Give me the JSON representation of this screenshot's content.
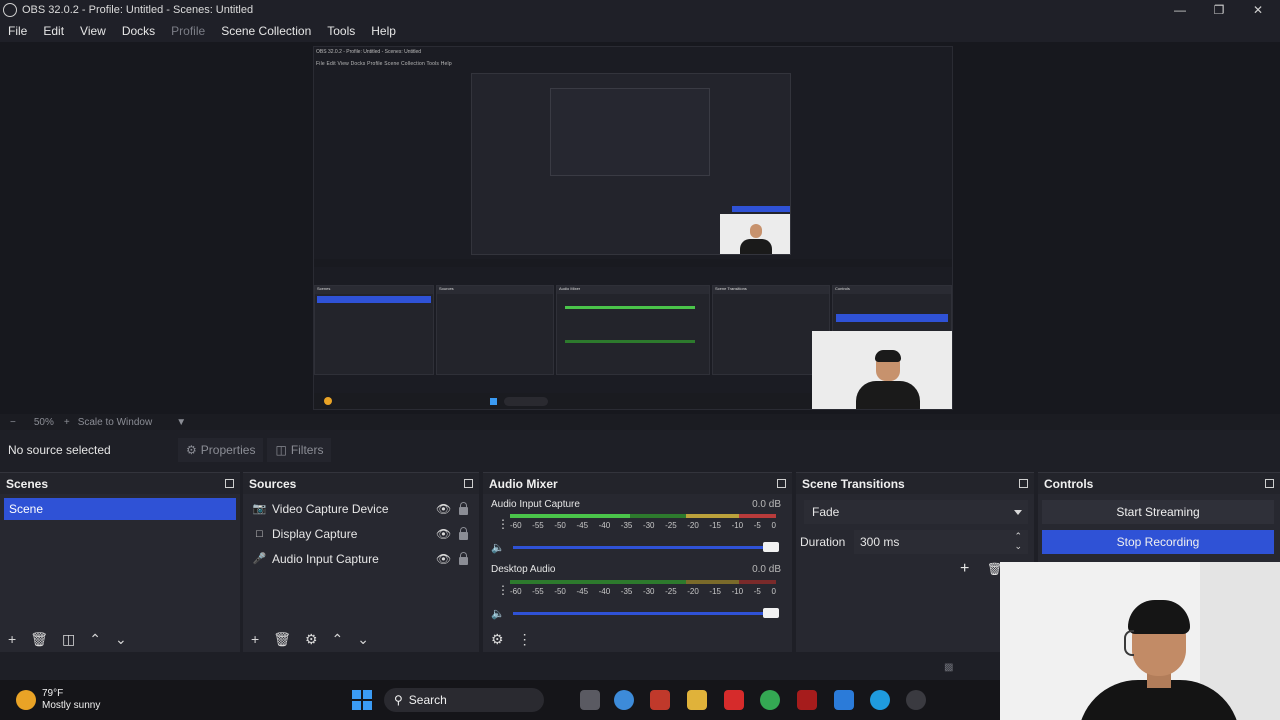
{
  "window": {
    "title": "OBS 32.0.2 - Profile: Untitled - Scenes: Untitled",
    "minimize_icon": "minimize-icon",
    "maximize_icon": "restore-icon",
    "close_icon": "close-icon"
  },
  "menu": [
    "File",
    "Edit",
    "View",
    "Docks",
    "Profile",
    "Scene Collection",
    "Tools",
    "Help"
  ],
  "preview": {
    "inner_title": "OBS 32.0.2 - Profile: Untitled - Scenes: Untitled",
    "inner_menu": "File   Edit   View   Docks   Profile   Scene Collection   Tools   Help"
  },
  "scalebar": {
    "minus": "−",
    "zoom": "50%",
    "plus": "+",
    "scale_mode": "Scale to Window"
  },
  "source_toolbar": {
    "no_source": "No source selected",
    "properties": "Properties",
    "filters": "Filters"
  },
  "scenes": {
    "title": "Scenes",
    "items": [
      "Scene"
    ]
  },
  "sources": {
    "title": "Sources",
    "items": [
      {
        "label": "Video Capture Device",
        "icon": "camera-icon"
      },
      {
        "label": "Display Capture",
        "icon": "monitor-icon"
      },
      {
        "label": "Audio Input Capture",
        "icon": "microphone-icon"
      }
    ]
  },
  "mixer": {
    "title": "Audio Mixer",
    "channels": [
      {
        "name": "Audio Input Capture",
        "db": "0.0 dB",
        "level": 0.45
      },
      {
        "name": "Desktop Audio",
        "db": "0.0 dB",
        "level": 0.68
      }
    ],
    "scale": [
      "-60",
      "-55",
      "-50",
      "-45",
      "-40",
      "-35",
      "-30",
      "-25",
      "-20",
      "-15",
      "-10",
      "-5",
      "0"
    ]
  },
  "transitions": {
    "title": "Scene Transitions",
    "selected": "Fade",
    "duration_label": "Duration",
    "duration_value": "300 ms"
  },
  "controls": {
    "title": "Controls",
    "start_streaming": "Start Streaming",
    "stop_recording": "Stop Recording"
  },
  "taskbar": {
    "temperature": "79°F",
    "weather": "Mostly sunny",
    "search": "Search"
  },
  "colors": {
    "accent": "#2f52d6",
    "meter_green": "#4ac44a",
    "meter_yellow": "#bba13b",
    "meter_red": "#b83b3b"
  }
}
